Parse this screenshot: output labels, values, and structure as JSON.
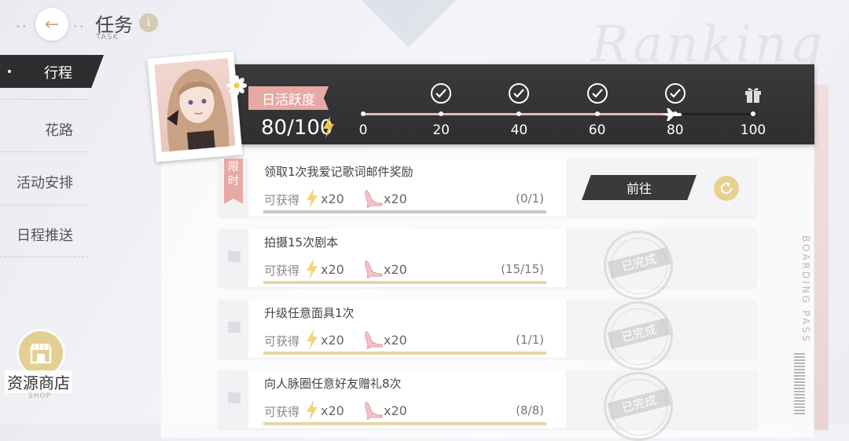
{
  "header": {
    "title": "任务",
    "subtitle": "TASK",
    "info_glyph": "i",
    "back_glyph": "←"
  },
  "nav": {
    "items": [
      {
        "label": "行程",
        "active": true
      },
      {
        "label": "花路",
        "active": false
      },
      {
        "label": "活动安排",
        "active": false
      },
      {
        "label": "日程推送",
        "active": false
      }
    ]
  },
  "shop": {
    "label": "资源商店",
    "sublabel": "SHOP"
  },
  "decor": {
    "script_text": "Ranking",
    "boarding_text": "BOARDING PASS"
  },
  "activity": {
    "tag_label": "日活跃度",
    "value_text": "80/100",
    "current": 80,
    "max": 100,
    "milestones": [
      {
        "label": "0",
        "value": 0,
        "icon": null
      },
      {
        "label": "20",
        "value": 20,
        "icon": "check-icon"
      },
      {
        "label": "40",
        "value": 40,
        "icon": "check-icon"
      },
      {
        "label": "60",
        "value": 60,
        "icon": "check-icon"
      },
      {
        "label": "80",
        "value": 80,
        "icon": "check-icon"
      },
      {
        "label": "100",
        "value": 100,
        "icon": "gift-icon"
      }
    ],
    "colors": {
      "fill": "#e8b7b3",
      "bar_bg": "#2f2f31",
      "tag": "#e7a9a4"
    }
  },
  "tasks": [
    {
      "limited": true,
      "limited_label": "限时",
      "title": "领取1次我爱记歌词邮件奖励",
      "obtain_label": "可获得",
      "reward1_icon": "lightning-icon",
      "reward1_qty": "x20",
      "reward2_icon": "high-heel-icon",
      "reward2_qty": "x20",
      "progress_text": "(0/1)",
      "progress": 0,
      "completed": false,
      "action_label": "前往"
    },
    {
      "limited": false,
      "title": "拍摄15次剧本",
      "obtain_label": "可获得",
      "reward1_icon": "lightning-icon",
      "reward1_qty": "x20",
      "reward2_icon": "high-heel-icon",
      "reward2_qty": "x20",
      "progress_text": "(15/15)",
      "progress": 1,
      "completed": true,
      "stamp_label": "已完成"
    },
    {
      "limited": false,
      "title": "升级任意面具1次",
      "obtain_label": "可获得",
      "reward1_icon": "lightning-icon",
      "reward1_qty": "x20",
      "reward2_icon": "high-heel-icon",
      "reward2_qty": "x20",
      "progress_text": "(1/1)",
      "progress": 1,
      "completed": true,
      "stamp_label": "已完成"
    },
    {
      "limited": false,
      "title": "向人脉圈任意好友赠礼8次",
      "obtain_label": "可获得",
      "reward1_icon": "lightning-icon",
      "reward1_qty": "x20",
      "reward2_icon": "high-heel-icon",
      "reward2_qty": "x20",
      "progress_text": "(8/8)",
      "progress": 1,
      "completed": true,
      "stamp_label": "已完成"
    }
  ]
}
